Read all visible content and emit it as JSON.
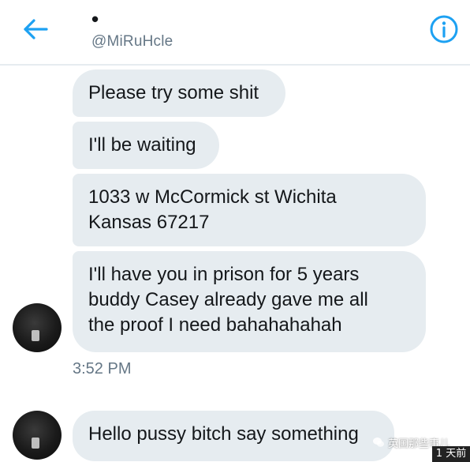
{
  "header": {
    "display_name": "•",
    "handle": "@MiRuHcle",
    "back_icon": "back-arrow-icon",
    "info_icon": "info-icon",
    "accent_color": "#1da1f2"
  },
  "messages": [
    {
      "text": "Please try some shit"
    },
    {
      "text": "I'll be waiting"
    },
    {
      "text": "1033 w McCormick st Wichita\nKansas 67217"
    },
    {
      "text": "I'll have you in prison for 5 years\nbuddy Casey already gave me all\nthe proof I need bahahahahah"
    },
    {
      "text": "Hello pussy bitch say something"
    }
  ],
  "timestamp": "3:52 PM",
  "colors": {
    "bubble_bg": "#e6ecf0",
    "text": "#14171a",
    "secondary_text": "#657786"
  },
  "watermark": {
    "text": "英国那些事儿",
    "corner_tag": "1 天前"
  }
}
